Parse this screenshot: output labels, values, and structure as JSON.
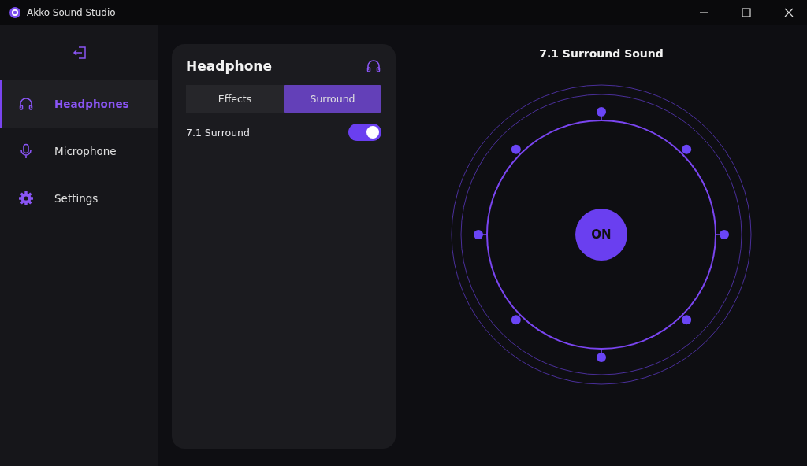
{
  "window": {
    "title": "Akko Sound Studio"
  },
  "sidebar": {
    "items": [
      {
        "label": "Headphones",
        "kind": "headphones",
        "selected": true
      },
      {
        "label": "Microphone",
        "kind": "microphone",
        "selected": false
      },
      {
        "label": "Settings",
        "kind": "settings",
        "selected": false
      }
    ]
  },
  "card": {
    "title": "Headphone",
    "tabs": [
      {
        "label": "Effects",
        "selected": false
      },
      {
        "label": "Surround",
        "selected": true
      }
    ],
    "toggle": {
      "label": "7.1 Surround",
      "on": true
    }
  },
  "surround": {
    "title": "7.1 Surround Sound",
    "center_button": "ON"
  }
}
